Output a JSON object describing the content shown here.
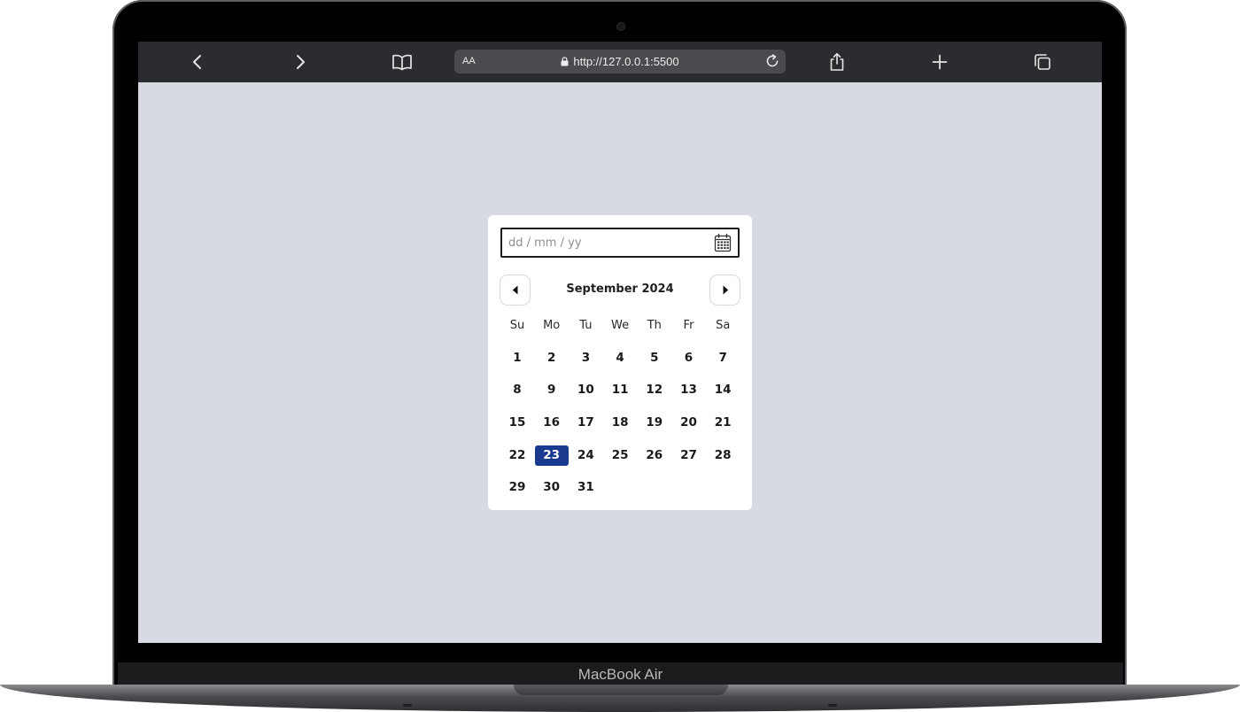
{
  "device": {
    "brand_label": "MacBook Air"
  },
  "browser": {
    "text_size_label": "AA",
    "url": "http://127.0.0.1:5500",
    "icons": [
      "back-icon",
      "forward-icon",
      "bookmarks-icon",
      "lock-icon",
      "reload-icon",
      "share-icon",
      "new-tab-icon",
      "tabs-icon"
    ]
  },
  "datepicker": {
    "placeholder": "dd / mm / yy",
    "value": "",
    "month_title": "September 2024",
    "weekdays": [
      "Su",
      "Mo",
      "Tu",
      "We",
      "Th",
      "Fr",
      "Sa"
    ],
    "first_weekday_index": 0,
    "days_in_month": 31,
    "selected_day": 23,
    "selected_color": "#1a3a8f",
    "icons": [
      "calendar-icon",
      "prev-month-icon",
      "next-month-icon"
    ]
  },
  "colors": {
    "page_background": "#d7dae3",
    "toolbar_background": "#2b2c2f"
  }
}
